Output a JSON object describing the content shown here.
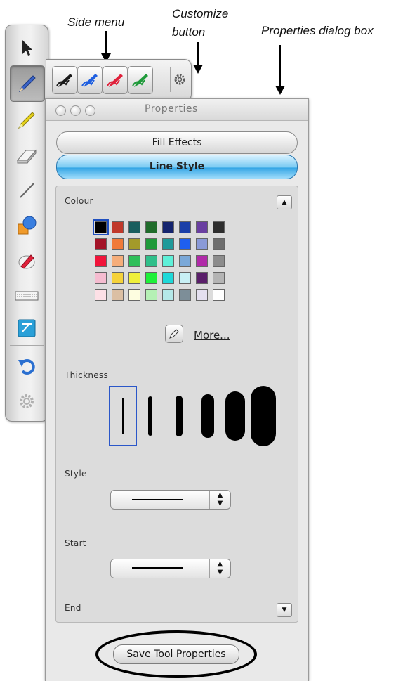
{
  "annotations": {
    "side_menu": "Side menu",
    "customize_line1": "Customize",
    "customize_line2": "button",
    "properties_dialog": "Properties dialog box"
  },
  "toolbar": {
    "tools": [
      {
        "name": "select",
        "icon": "arrow-pointer-icon",
        "selected": false
      },
      {
        "name": "pen",
        "icon": "pen-icon",
        "selected": true
      },
      {
        "name": "highlighter",
        "icon": "highlighter-icon",
        "selected": false
      },
      {
        "name": "eraser",
        "icon": "eraser-icon",
        "selected": false
      },
      {
        "name": "line",
        "icon": "line-icon",
        "selected": false
      },
      {
        "name": "shapes",
        "icon": "shapes-icon",
        "selected": false
      },
      {
        "name": "magic-pen",
        "icon": "magic-pen-icon",
        "selected": false
      },
      {
        "name": "keyboard",
        "icon": "keyboard-icon",
        "selected": false
      },
      {
        "name": "notebook",
        "icon": "notebook-icon",
        "selected": false
      },
      {
        "name": "undo",
        "icon": "undo-icon",
        "selected": false
      },
      {
        "name": "settings",
        "icon": "gear-icon",
        "selected": false
      }
    ]
  },
  "side_menu": {
    "pens": [
      {
        "name": "black-pen",
        "color": "#1a1a1a"
      },
      {
        "name": "blue-pen",
        "color": "#1f5fe0"
      },
      {
        "name": "red-pen",
        "color": "#e0203a"
      },
      {
        "name": "green-pen",
        "color": "#1f9a3a"
      }
    ],
    "customize_icon": "gear-icon"
  },
  "properties": {
    "title": "Properties",
    "tabs": {
      "fill_effects": "Fill Effects",
      "line_style": "Line Style"
    },
    "colour_label": "Colour",
    "more_label": "More...",
    "thickness_label": "Thickness",
    "style_label": "Style",
    "start_label": "Start",
    "end_label": "End",
    "save_label": "Save Tool Properties",
    "selected_colour": "#000000",
    "selected_thickness_index": 1,
    "palette": [
      [
        "#000000",
        "#c0392b",
        "#1a5e5e",
        "#1f6b2a",
        "#14246e",
        "#1b3fa8",
        "#6a3fa1",
        "#2e2e2e"
      ],
      [
        "#a31428",
        "#f07a3a",
        "#a39a2a",
        "#1f9a3a",
        "#1f9a9a",
        "#1f5ff0",
        "#8a9ad8",
        "#6e6e6e"
      ],
      [
        "#f0143a",
        "#f5ad7a",
        "#2fbf5a",
        "#2fbf8a",
        "#5ef0d8",
        "#7aa8d8",
        "#b02aa8",
        "#8c8c8c"
      ],
      [
        "#f5bcd0",
        "#f5d23a",
        "#f0f03a",
        "#1ff03a",
        "#1fd8d8",
        "#c8f0f5",
        "#5a1f6a",
        "#b4b4b4"
      ],
      [
        "#fde0e6",
        "#dbbfa3",
        "#fdfde0",
        "#b5f0b5",
        "#b5e8e8",
        "#7d8e98",
        "#e4e0f0",
        "#ffffff"
      ]
    ],
    "thickness_levels": [
      1,
      3,
      6,
      10,
      16,
      26,
      34
    ]
  }
}
